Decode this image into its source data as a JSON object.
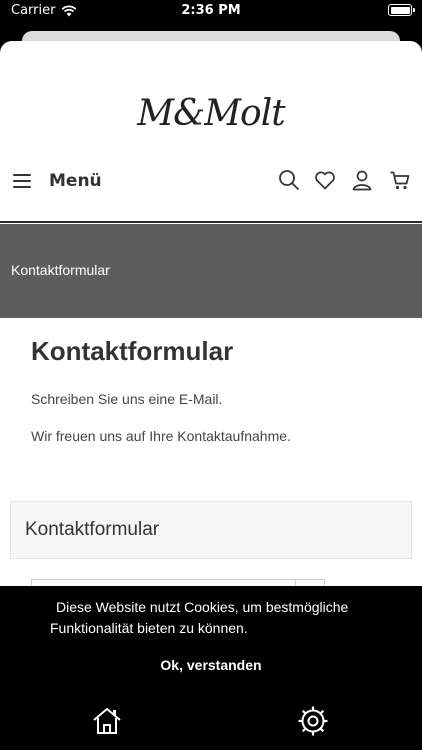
{
  "status_bar": {
    "carrier": "Carrier",
    "time": "2:36 PM"
  },
  "header": {
    "logo_text": "M&Molt",
    "menu_label": "Menü",
    "icons": [
      "menu-icon",
      "search-icon",
      "heart-icon",
      "user-icon",
      "cart-icon"
    ]
  },
  "banner": {
    "breadcrumb": "Kontaktformular",
    "background_color": "#5d5d5d"
  },
  "main": {
    "title": "Kontaktformular",
    "paragraphs": [
      "Schreiben Sie uns eine E-Mail.",
      "Wir freuen uns auf Ihre Kontaktaufnahme."
    ],
    "form_title": "Kontaktformular"
  },
  "cookie_banner": {
    "message": "Diese Website nutzt Cookies, um bestmögliche Funktionalität bieten zu können.",
    "accept_label": "Ok, verstanden",
    "icons": [
      "home-icon",
      "settings-icon"
    ]
  }
}
